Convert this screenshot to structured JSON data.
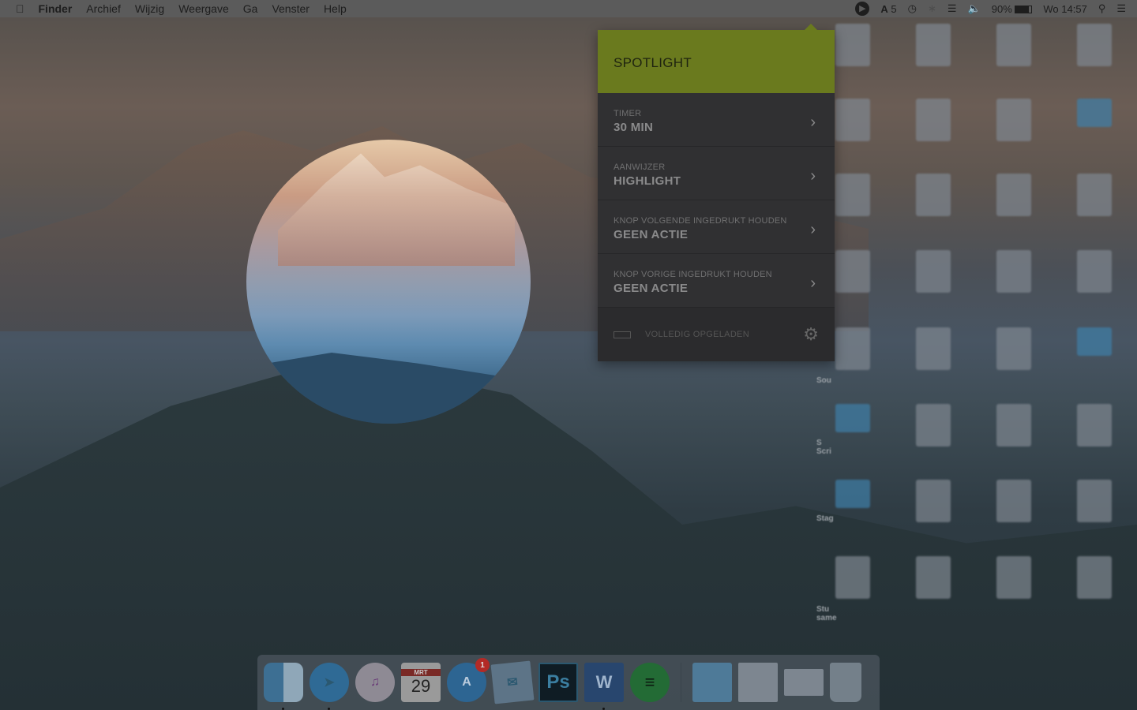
{
  "menubar": {
    "items": [
      "Finder",
      "Archief",
      "Wijzig",
      "Weergave",
      "Ga",
      "Venster",
      "Help"
    ],
    "status": {
      "adobe_count": "5",
      "battery": "90%",
      "clock": "Wo 14:57"
    }
  },
  "popup": {
    "title": "SPOTLIGHT",
    "accent": "#6a7a1e",
    "rows": [
      {
        "label": "TIMER",
        "value": "30 MIN"
      },
      {
        "label": "AANWIJZER",
        "value": "HIGHLIGHT"
      },
      {
        "label": "KNOP VOLGENDE INGEDRUKT HOUDEN",
        "value": "GEEN ACTIE"
      },
      {
        "label": "KNOP VORIGE INGEDRUKT HOUDEN",
        "value": "GEEN ACTIE"
      }
    ],
    "status": "VOLLEDIG OPGELADEN"
  },
  "desktop": {
    "visible_labels": [
      "Sou",
      "S",
      "Scri",
      "Stag",
      "Stu",
      "same"
    ]
  },
  "dock": {
    "calendar_month": "MRT",
    "calendar_day": "29",
    "appstore_badge": "1",
    "ps": "Ps",
    "word": "W"
  }
}
